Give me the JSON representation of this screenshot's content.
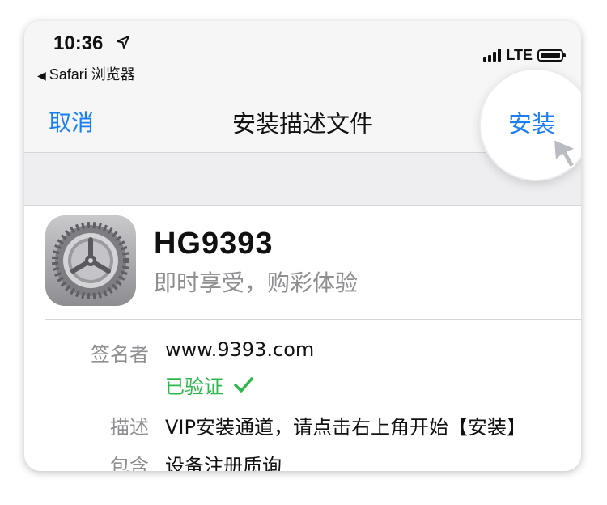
{
  "status_bar": {
    "time": "10:36",
    "back_label": "Safari 浏览器",
    "network": "LTE"
  },
  "nav": {
    "cancel_label": "取消",
    "title": "安装描述文件",
    "install_label": "安装"
  },
  "profile": {
    "name": "HG9393",
    "subtitle": "即时享受，购彩体验"
  },
  "details": {
    "signer_label": "签名者",
    "signer_value": "www.9393.com",
    "verified_label": "已验证",
    "description_label": "描述",
    "description_value": "VIP安装通道，请点击右上角开始【安装】",
    "contains_label": "包含",
    "contains_value": "设备注册质询"
  },
  "colors": {
    "accent": "#1a7ff2",
    "verified": "#2db84b",
    "secondary_text": "#8e8e93"
  },
  "icons": {
    "app_icon": "settings-gear-icon",
    "location": "location-arrow-icon",
    "back": "back-triangle-icon",
    "signal": "signal-bars-icon",
    "battery": "battery-icon",
    "verified": "checkmark-icon",
    "pointer": "pointer-arrow-icon"
  }
}
